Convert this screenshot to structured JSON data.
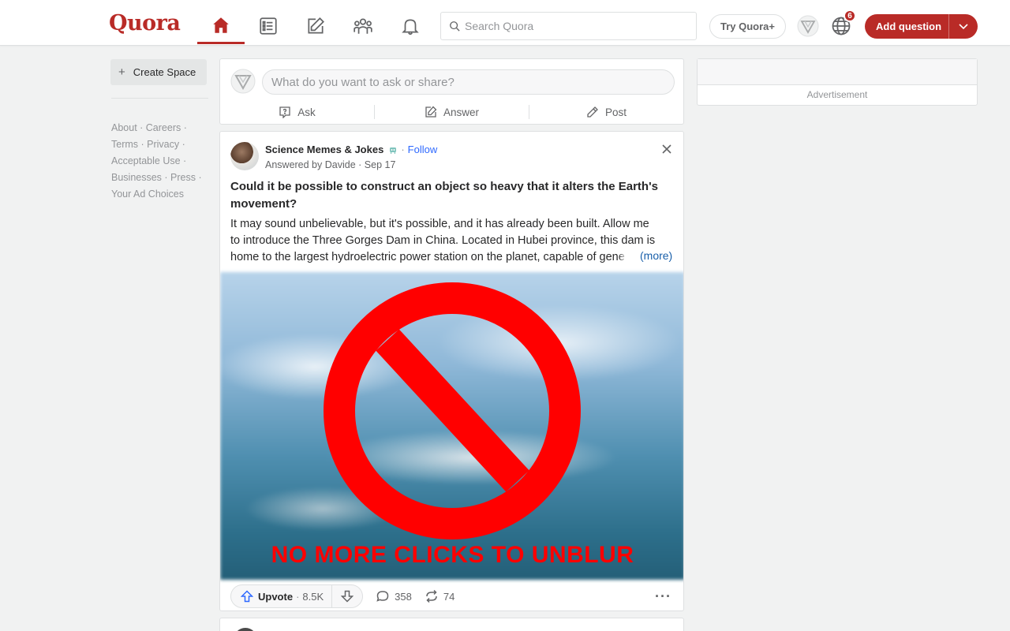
{
  "header": {
    "logo": "Quora",
    "search_placeholder": "Search Quora",
    "try_plus": "Try Quora+",
    "notification_count": "6",
    "add_question": "Add question",
    "nav": [
      "home-icon",
      "following-icon",
      "answer-icon",
      "spaces-icon",
      "notifications-icon"
    ]
  },
  "sidebar": {
    "create_space": "Create Space",
    "footer_links": [
      "About",
      "Careers",
      "Terms",
      "Privacy",
      "Acceptable Use",
      "Businesses",
      "Press",
      "Your Ad Choices"
    ]
  },
  "ask_box": {
    "placeholder": "What do you want to ask or share?",
    "ask": "Ask",
    "answer": "Answer",
    "post": "Post"
  },
  "post": {
    "space_name": "Science Memes & Jokes",
    "follow": "Follow",
    "answered_by": "Answered by Davide",
    "date": "Sep 17",
    "question": "Could it be possible to construct an object so heavy that it alters the Earth's movement?",
    "answer_line1": "It may sound unbelievable, but it's possible, and it has already been built. Allow me",
    "answer_line2": "to introduce the Three Gorges Dam in China. Located in Hubei province, this dam is",
    "answer_line3": "home to the largest hydroelectric power station on the planet, capable of gen",
    "answer_fade": "e",
    "more": "(more)",
    "overlay_text": "NO MORE CLICKS TO UNBLUR",
    "upvote_label": "Upvote",
    "upvote_count": "8.5K",
    "comments": "358",
    "shares": "74",
    "colors": {
      "brand": "#b92b27",
      "link": "#2e69ff",
      "ban": "#ff0000"
    }
  },
  "right": {
    "ad_label": "Advertisement"
  }
}
